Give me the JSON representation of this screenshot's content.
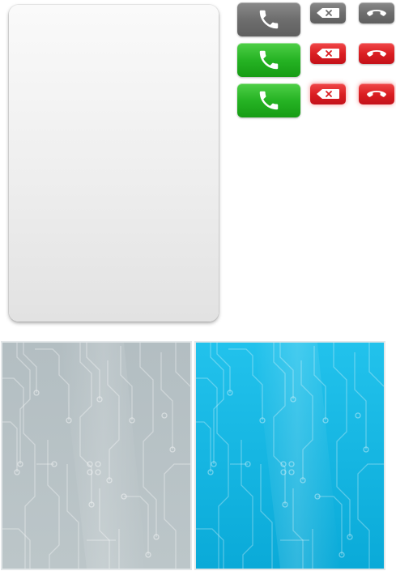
{
  "colors": {
    "card_top": "#fafafa",
    "card_bottom": "#e2e2e2",
    "gray_button": "#6e6e6e",
    "green_button": "#26b324",
    "red_button": "#db1f22",
    "panel_gray_bg": "#b5c0c4",
    "panel_blue_bg": "#22bfea",
    "circuit_trace": "#ffffff"
  },
  "sprites": {
    "call_button_default": {
      "icon": "phone-icon",
      "state": "default",
      "color": "gray"
    },
    "call_button_active": {
      "icon": "phone-icon",
      "state": "active",
      "color": "green"
    },
    "call_button_pressed": {
      "icon": "phone-icon",
      "state": "pressed",
      "color": "green"
    },
    "delete_button_default": {
      "icon": "backspace-icon",
      "state": "default",
      "color": "gray"
    },
    "delete_button_active": {
      "icon": "backspace-icon",
      "state": "active",
      "color": "red"
    },
    "delete_button_pressed": {
      "icon": "backspace-icon",
      "state": "pressed",
      "color": "red"
    },
    "hangup_button_default": {
      "icon": "hang-up-icon",
      "state": "default",
      "color": "gray"
    },
    "hangup_button_active": {
      "icon": "hang-up-icon",
      "state": "active",
      "color": "red"
    },
    "hangup_button_pressed": {
      "icon": "hang-up-icon",
      "state": "pressed",
      "color": "red"
    }
  },
  "backgrounds": [
    {
      "name": "circuit-background-gray",
      "pattern": "circuit-board"
    },
    {
      "name": "circuit-background-blue",
      "pattern": "circuit-board"
    }
  ]
}
